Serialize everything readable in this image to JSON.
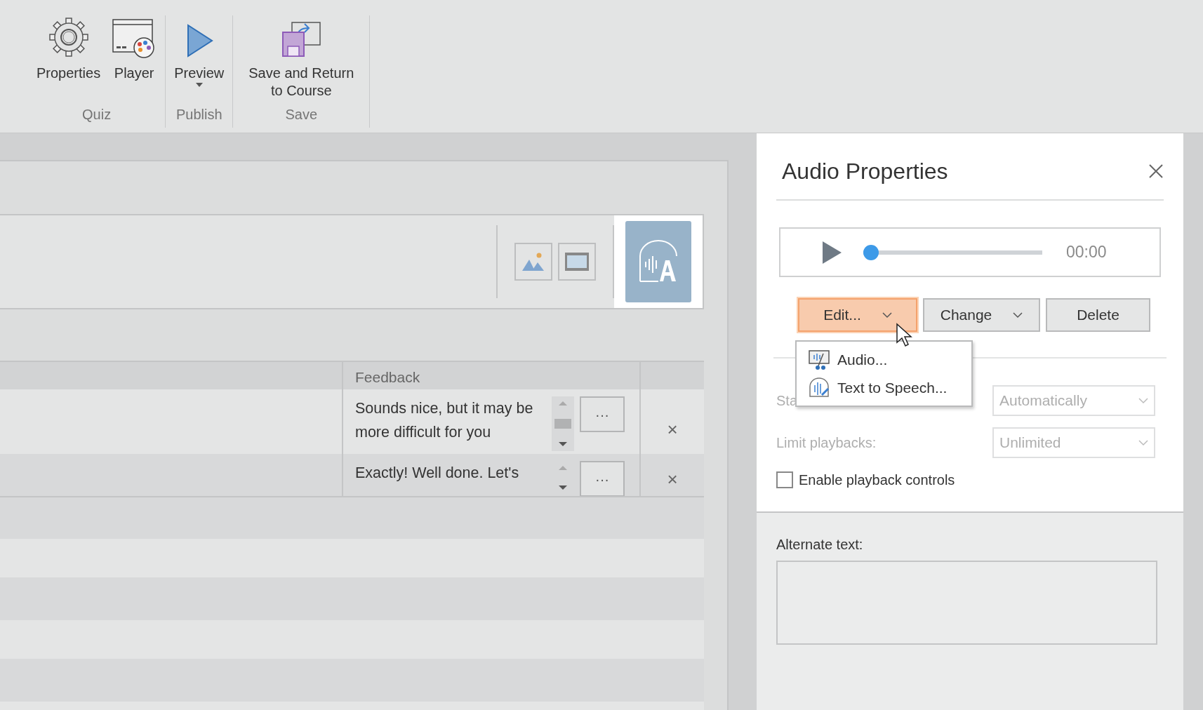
{
  "ribbon": {
    "groups": [
      {
        "label": "Quiz",
        "buttons": [
          {
            "label": "Properties",
            "kind": "gear",
            "dropdown": false
          },
          {
            "label": "Player",
            "kind": "player",
            "dropdown": false
          }
        ]
      },
      {
        "label": "Publish",
        "buttons": [
          {
            "label": "Preview",
            "kind": "play",
            "dropdown": true
          }
        ]
      },
      {
        "label": "Save",
        "buttons": [
          {
            "label": "Save and Return to Course",
            "kind": "save",
            "dropdown": false
          }
        ]
      }
    ]
  },
  "media_toolbar": {
    "buttons": [
      {
        "kind": "image",
        "selected": false
      },
      {
        "kind": "video",
        "selected": false
      },
      {
        "kind": "audio",
        "selected": true
      }
    ]
  },
  "table": {
    "columns": [
      "Feedback"
    ],
    "rows": [
      {
        "feedback": "Sounds nice, but it may be more difficult for you",
        "more_button": "···",
        "delete_button": "×"
      },
      {
        "feedback": "Exactly! Well done. Let's",
        "more_button": "···",
        "delete_button": "×"
      }
    ]
  },
  "audio_panel": {
    "title": "Audio Properties",
    "player": {
      "time": "00:00",
      "level": 0
    },
    "buttons": [
      {
        "label": "Edit...",
        "kind": "dropdown",
        "active": true
      },
      {
        "label": "Change",
        "kind": "dropdown",
        "active": false
      },
      {
        "label": "Delete",
        "kind": "plain",
        "active": false
      }
    ],
    "menu": [
      {
        "label": "Audio...",
        "kind": "audio"
      },
      {
        "label": "Text to Speech...",
        "kind": "tts"
      }
    ],
    "fields": [
      {
        "label": "Sta",
        "value": "Automatically",
        "disabled": true
      },
      {
        "label": "Limit playbacks:",
        "value": "Unlimited",
        "disabled": true
      }
    ],
    "checkbox": {
      "label": "Enable playback controls",
      "checked": false
    },
    "alternate_text": {
      "label": "Alternate text:"
    }
  }
}
